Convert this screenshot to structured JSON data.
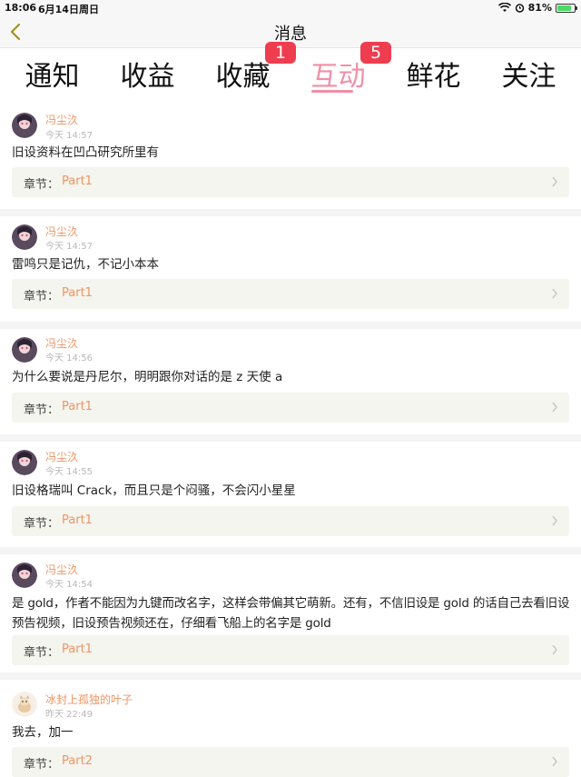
{
  "status_bar": {
    "time": "18:06",
    "date": "6月14日周日",
    "battery": "81%",
    "battery_level": 0.81,
    "icons": [
      "wifi-icon",
      "alarm-icon",
      "battery-icon"
    ]
  },
  "header": {
    "title": "消息",
    "back_icon": "chevron-left-icon"
  },
  "tabs": [
    {
      "label": "通知",
      "badge": ""
    },
    {
      "label": "收益",
      "badge": ""
    },
    {
      "label": "收藏",
      "badge": "1"
    },
    {
      "label": "互动",
      "badge": "5",
      "active": true
    },
    {
      "label": "鲜花",
      "badge": ""
    },
    {
      "label": "关注",
      "badge": ""
    }
  ],
  "messages": [
    {
      "user": "冯尘汣",
      "time": "今天 14:57",
      "content": "旧设资料在凹凸研究所里有",
      "chapter_label": "章节：",
      "chapter": "Part1"
    },
    {
      "user": "冯尘汣",
      "time": "今天 14:57",
      "content": "雷鸣只是记仇，不记小本本",
      "chapter_label": "章节：",
      "chapter": "Part1"
    },
    {
      "user": "冯尘汣",
      "time": "今天 14:56",
      "content": "为什么要说是丹尼尔，明明跟你对话的是 z 天使 a",
      "chapter_label": "章节：",
      "chapter": "Part1"
    },
    {
      "user": "冯尘汣",
      "time": "今天 14:55",
      "content": "旧设格瑞叫 Crack，而且只是个闷骚，不会闪小星星",
      "chapter_label": "章节：",
      "chapter": "Part1"
    },
    {
      "user": "冯尘汣",
      "time": "今天 14:54",
      "content": "是 gold，作者不能因为九键而改名字，这样会带偏其它萌新。还有，不信旧设是 gold 的话自己去看旧设预告视频，旧设预告视频还在，仔细看飞船上的名字是 gold",
      "chapter_label": "章节：",
      "chapter": "Part1"
    },
    {
      "user": "冰封上孤独的叶子",
      "time": "昨天 22:49",
      "content": "我去，加一",
      "chapter_label": "章节：",
      "chapter": "Part2"
    }
  ],
  "colors": {
    "accent_pink": "#f08fa6",
    "badge_red": "#ee3d4f",
    "username_orange": "#f09464",
    "chapter_bg": "#f5f5ef"
  }
}
